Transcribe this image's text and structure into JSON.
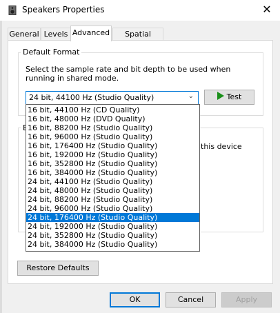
{
  "window": {
    "title": "Speakers Properties",
    "close_glyph": "✕",
    "icon": "speaker-icon"
  },
  "tabs": [
    {
      "label": "General",
      "active": false
    },
    {
      "label": "Levels",
      "active": false
    },
    {
      "label": "Advanced",
      "active": true
    },
    {
      "label": "Spatial sound",
      "active": false
    }
  ],
  "default_format": {
    "group_label": "Default Format",
    "description": "Select the sample rate and bit depth to be used when running in shared mode.",
    "selected": "24 bit, 44100 Hz (Studio Quality)",
    "test_label": "Test",
    "options": [
      "16 bit, 44100 Hz (CD Quality)",
      "16 bit, 48000 Hz (DVD Quality)",
      "16 bit, 88200 Hz (Studio Quality)",
      "16 bit, 96000 Hz (Studio Quality)",
      "16 bit, 176400 Hz (Studio Quality)",
      "16 bit, 192000 Hz (Studio Quality)",
      "16 bit, 352800 Hz (Studio Quality)",
      "16 bit, 384000 Hz (Studio Quality)",
      "24 bit, 44100 Hz (Studio Quality)",
      "24 bit, 48000 Hz (Studio Quality)",
      "24 bit, 88200 Hz (Studio Quality)",
      "24 bit, 96000 Hz (Studio Quality)",
      "24 bit, 176400 Hz (Studio Quality)",
      "24 bit, 192000 Hz (Studio Quality)",
      "24 bit, 352800 Hz (Studio Quality)",
      "24 bit, 384000 Hz (Studio Quality)"
    ],
    "highlighted": "24 bit, 176400 Hz (Studio Quality)"
  },
  "obscured_group": {
    "label_fragment": "E",
    "text_fragment": "this device"
  },
  "restore_defaults_label": "Restore Defaults",
  "footer": {
    "ok_label": "OK",
    "cancel_label": "Cancel",
    "apply_label": "Apply"
  },
  "colors": {
    "accent": "#0078d7",
    "test_arrow": "#1a8f1a"
  }
}
